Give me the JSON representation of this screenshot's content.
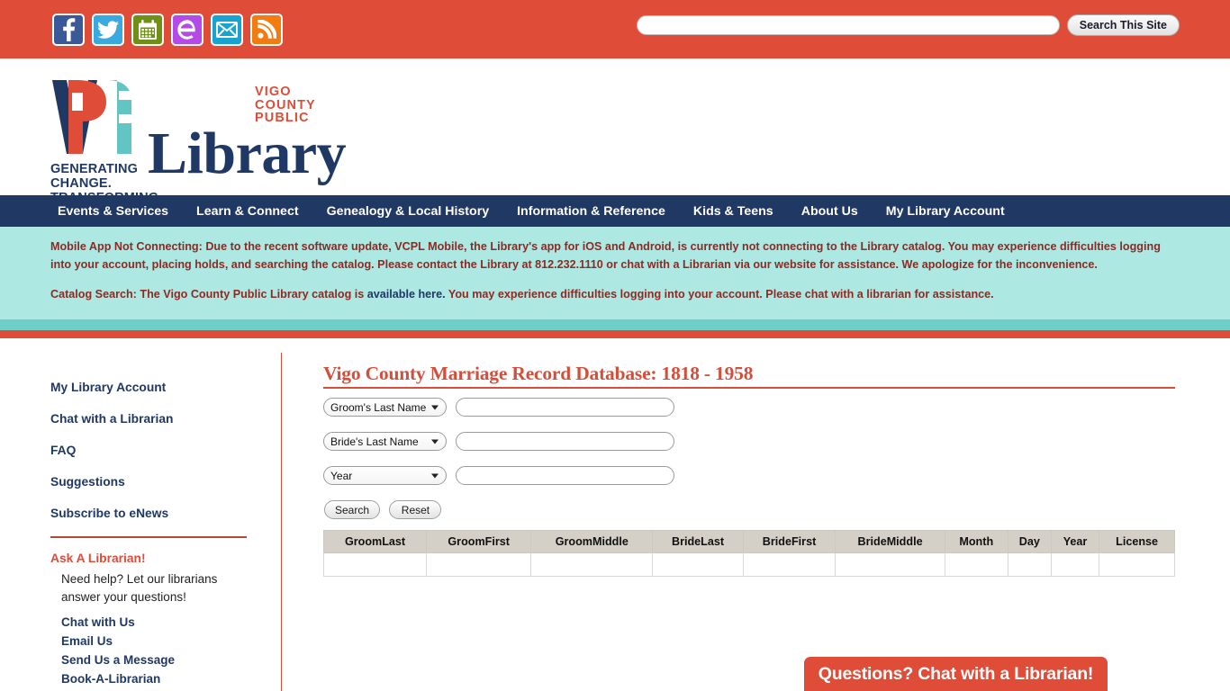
{
  "topbar": {
    "social_icons": [
      {
        "name": "facebook-icon",
        "label": "Facebook"
      },
      {
        "name": "twitter-icon",
        "label": "Twitter"
      },
      {
        "name": "calendar-icon",
        "label": "Events Calendar"
      },
      {
        "name": "evanced-e-icon",
        "label": "Evanced"
      },
      {
        "name": "email-envelope-icon",
        "label": "Email"
      },
      {
        "name": "rss-feed-icon",
        "label": "RSS Feed"
      }
    ],
    "search_value": "",
    "search_placeholder": "",
    "search_button_label": "Search This Site"
  },
  "logo": {
    "eyebrow": "VIGO COUNTY PUBLIC",
    "wordmark": "Library",
    "tagline": "GENERATING CHANGE. TRANSFORMING LIVES."
  },
  "nav": {
    "items": [
      {
        "label": "Events & Services"
      },
      {
        "label": "Learn & Connect"
      },
      {
        "label": "Genealogy & Local History"
      },
      {
        "label": "Information & Reference"
      },
      {
        "label": "Kids & Teens"
      },
      {
        "label": "About Us"
      },
      {
        "label": "My Library Account"
      }
    ]
  },
  "alert": {
    "line1": "Mobile App Not Connecting: Due to the recent software update, VCPL Mobile, the Library's app for iOS and Android, is currently not connecting to the Library catalog. You may experience difficulties logging into your account, placing holds, and searching the catalog. Please contact the Library at 812.232.1110 or chat with a Librarian via our website for assistance. We apologize for the inconvenience.",
    "line2_before": "Catalog Search: The Vigo County Public Library catalog is ",
    "line2_link": "available here.",
    "line2_after": " You may experience difficulties logging into your account. Please chat with a librarian for assistance."
  },
  "sidebar": {
    "links": [
      {
        "label": "My Library Account"
      },
      {
        "label": "Chat with a Librarian"
      },
      {
        "label": "FAQ"
      },
      {
        "label": "Suggestions"
      },
      {
        "label": "Subscribe to eNews"
      }
    ],
    "ask_title": "Ask A Librarian!",
    "ask_blurb": "Need help? Let our librarians answer your questions!",
    "ask_links": [
      {
        "label": "Chat with Us"
      },
      {
        "label": "Email Us"
      },
      {
        "label": "Send Us a Message"
      },
      {
        "label": "Book-A-Librarian"
      }
    ]
  },
  "main": {
    "page_title": "Vigo County Marriage Record Database: 1818 - 1958",
    "form": {
      "rows": [
        {
          "select_value": "Groom's Last Name",
          "input_value": "",
          "input_placeholder": ""
        },
        {
          "select_value": "Bride's Last Name",
          "input_value": "",
          "input_placeholder": ""
        },
        {
          "select_value": "Year",
          "input_value": "",
          "input_placeholder": ""
        }
      ],
      "search_label": "Search",
      "reset_label": "Reset"
    },
    "results": {
      "columns": [
        "GroomLast",
        "GroomFirst",
        "GroomMiddle",
        "BrideLast",
        "BrideFirst",
        "BrideMiddle",
        "Month",
        "Day",
        "Year",
        "License"
      ],
      "rows": []
    }
  },
  "chat_widget": {
    "label": "Questions? Chat with a Librarian!"
  },
  "colors": {
    "brand_orange": "#df4c38",
    "brand_navy": "#1f3864",
    "alert_teal": "#ade8e3",
    "strip_teal": "#6ecfc9",
    "title_red": "#d34f3c"
  }
}
